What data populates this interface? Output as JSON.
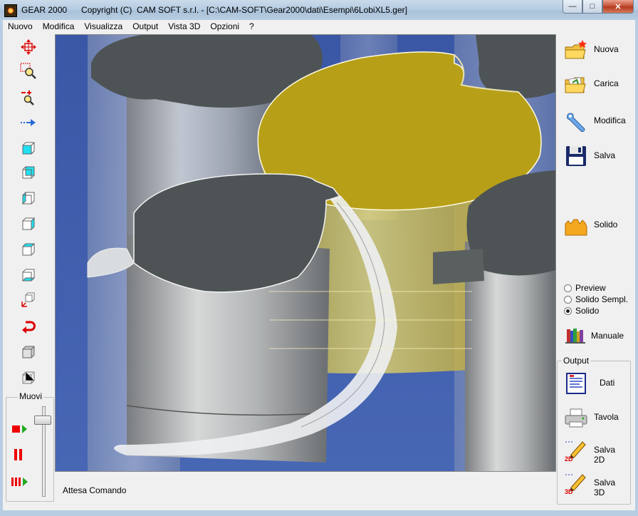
{
  "window": {
    "title": "GEAR 2000      Copyright (C)  CAM SOFT s.r.l. - [C:\\CAM-SOFT\\Gear2000\\dati\\Esempi\\6LobiXL5.ger]",
    "controls": {
      "minimize": "—",
      "maximize": "□",
      "close": "✕"
    }
  },
  "menu": [
    "Nuovo",
    "Modifica",
    "Visualizza",
    "Output",
    "Vista 3D",
    "Opzioni",
    "?"
  ],
  "left_toolbar": {
    "tools": [
      "pan-icon",
      "zoom-window-icon",
      "zoom-in-out-icon",
      "move-arrow-icon",
      "view-cube-front-icon",
      "view-cube-back-icon",
      "view-cube-left-icon",
      "view-cube-right-icon",
      "view-cube-top-icon",
      "view-cube-bottom-icon",
      "axes-view-icon",
      "undo-rotate-icon",
      "solid-cube-icon",
      "wire-cube-icon"
    ]
  },
  "muovi": {
    "label": "Muovi",
    "slider_position": 0.1
  },
  "status": {
    "text": "Attesa Comando"
  },
  "right_panel": {
    "buttons": [
      {
        "id": "nuova",
        "label": "Nuova"
      },
      {
        "id": "carica",
        "label": "Carica"
      },
      {
        "id": "modifica",
        "label": "Modifica"
      },
      {
        "id": "salva",
        "label": "Salva"
      },
      {
        "id": "solido",
        "label": "Solido"
      }
    ],
    "render_modes": [
      {
        "label": "Preview",
        "selected": false
      },
      {
        "label": "Solido Sempl.",
        "selected": false
      },
      {
        "label": "Solido",
        "selected": true
      }
    ],
    "manuale_label": "Manuale",
    "output": {
      "label": "Output",
      "buttons": [
        {
          "id": "dati",
          "label": "Dati"
        },
        {
          "id": "tavola",
          "label": "Tavola"
        },
        {
          "id": "salva2d",
          "label": "Salva 2D"
        },
        {
          "id": "salva3d",
          "label": "Salva 3D"
        }
      ]
    }
  },
  "colors": {
    "viewport_bg": "#3e5ca6",
    "gear_gold": "#b8a11a",
    "gear_gray": "#5a5f60",
    "accent_red": "#d40000"
  }
}
